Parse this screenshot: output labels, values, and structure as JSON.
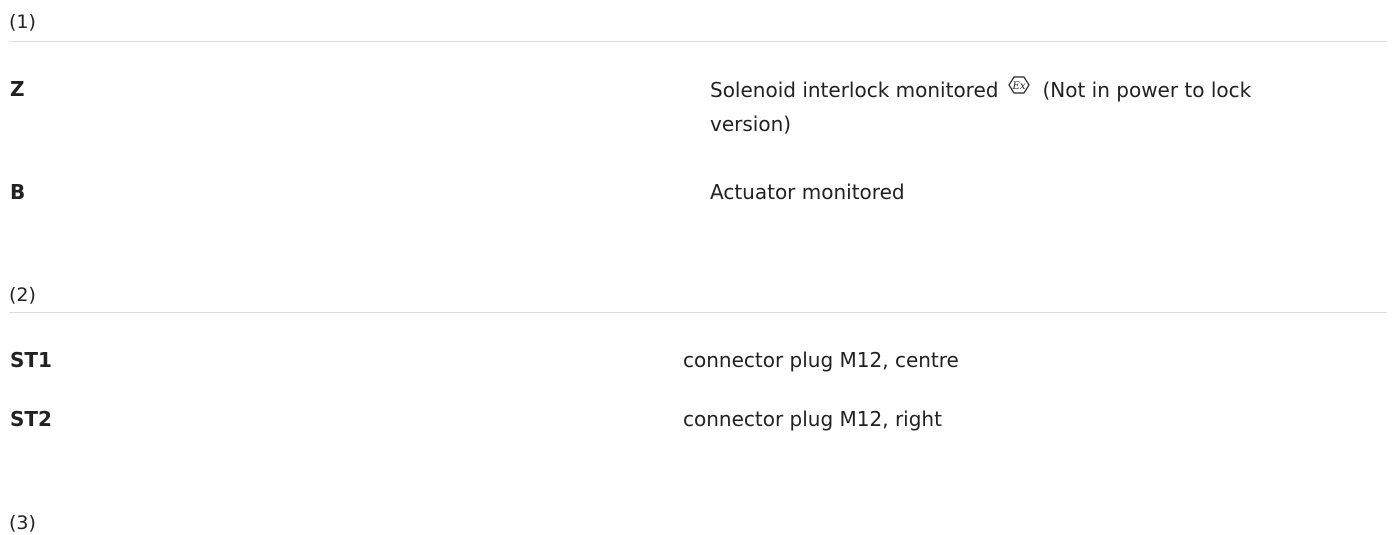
{
  "sections": [
    {
      "label": "(1)",
      "rows": [
        {
          "key": "Z",
          "value": "Solenoid interlock monitored",
          "icon": "ex-explosion-protection-icon",
          "suffix": "(Not in power to lock",
          "suffix_line2": "version)"
        },
        {
          "key": "B",
          "value": "Actuator monitored"
        }
      ]
    },
    {
      "label": "(2)",
      "rows": [
        {
          "key": "ST1",
          "value": "connector plug M12, centre"
        },
        {
          "key": "ST2",
          "value": "connector plug M12, right"
        }
      ]
    },
    {
      "label": "(3)"
    }
  ]
}
